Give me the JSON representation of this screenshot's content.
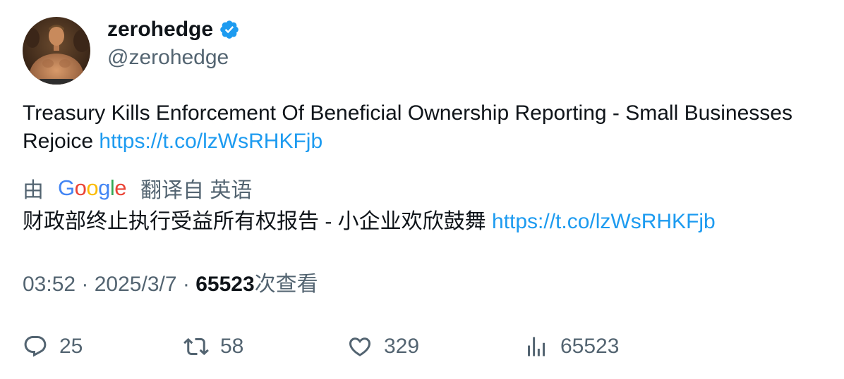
{
  "user": {
    "display_name": "zerohedge",
    "handle": "@zerohedge",
    "verified": true
  },
  "tweet": {
    "text": "Treasury Kills Enforcement Of Beneficial Ownership Reporting - Small Businesses Rejoice",
    "link": "https://t.co/lzWsRHKFjb"
  },
  "translation": {
    "by_label": "由",
    "provider": "Google",
    "from_label": "翻译自 英语",
    "text": "财政部终止执行受益所有权报告 - 小企业欢欣鼓舞",
    "link": "https://t.co/lzWsRHKFjb"
  },
  "meta": {
    "time": "03:52",
    "separator": " · ",
    "date": "2025/3/7",
    "views_count": "65523",
    "views_label": "次查看"
  },
  "actions": {
    "replies": "25",
    "retweets": "58",
    "likes": "329",
    "views": "65523"
  },
  "colors": {
    "link": "#1d9bf0",
    "verified": "#1d9bf0",
    "muted": "#536471",
    "text": "#0f1419"
  }
}
